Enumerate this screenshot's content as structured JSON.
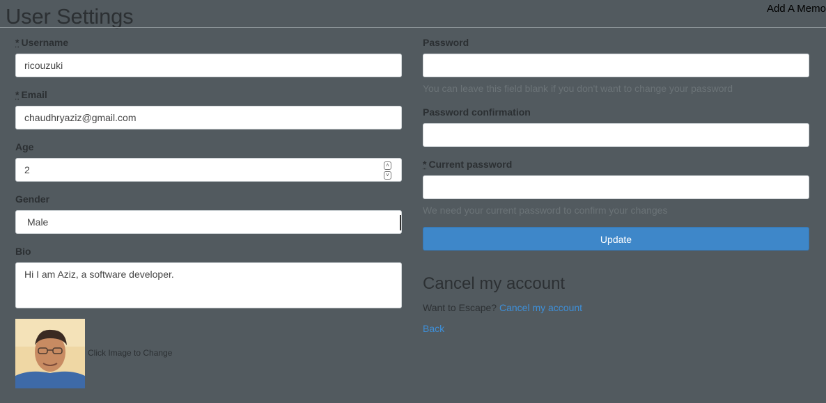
{
  "header": {
    "title": "User Settings",
    "memo_link": "Add A Memo"
  },
  "form": {
    "required_marker": "*",
    "username": {
      "label": "Username",
      "value": "ricouzuki"
    },
    "email": {
      "label": "Email",
      "value": "chaudhryaziz@gmail.com"
    },
    "age": {
      "label": "Age",
      "value": "2"
    },
    "gender": {
      "label": "Gender",
      "value": "Male"
    },
    "bio": {
      "label": "Bio",
      "value": "Hi I am Aziz, a software developer."
    },
    "avatar_caption": "Click Image to Change",
    "password": {
      "label": "Password",
      "value": "",
      "help": "You can leave this field blank if you don't want to change your password"
    },
    "password_confirmation": {
      "label": "Password confirmation",
      "value": ""
    },
    "current_password": {
      "label": "Current password",
      "value": "",
      "help": "We need your current password to confirm your changes"
    },
    "update_button": "Update"
  },
  "cancel_account": {
    "heading": "Cancel my account",
    "prompt": "Want to Escape?",
    "link": "Cancel my account"
  },
  "back_link": "Back",
  "colors": {
    "background": "#525a5f",
    "button": "#3e87c9",
    "link": "#3e8fd8"
  }
}
